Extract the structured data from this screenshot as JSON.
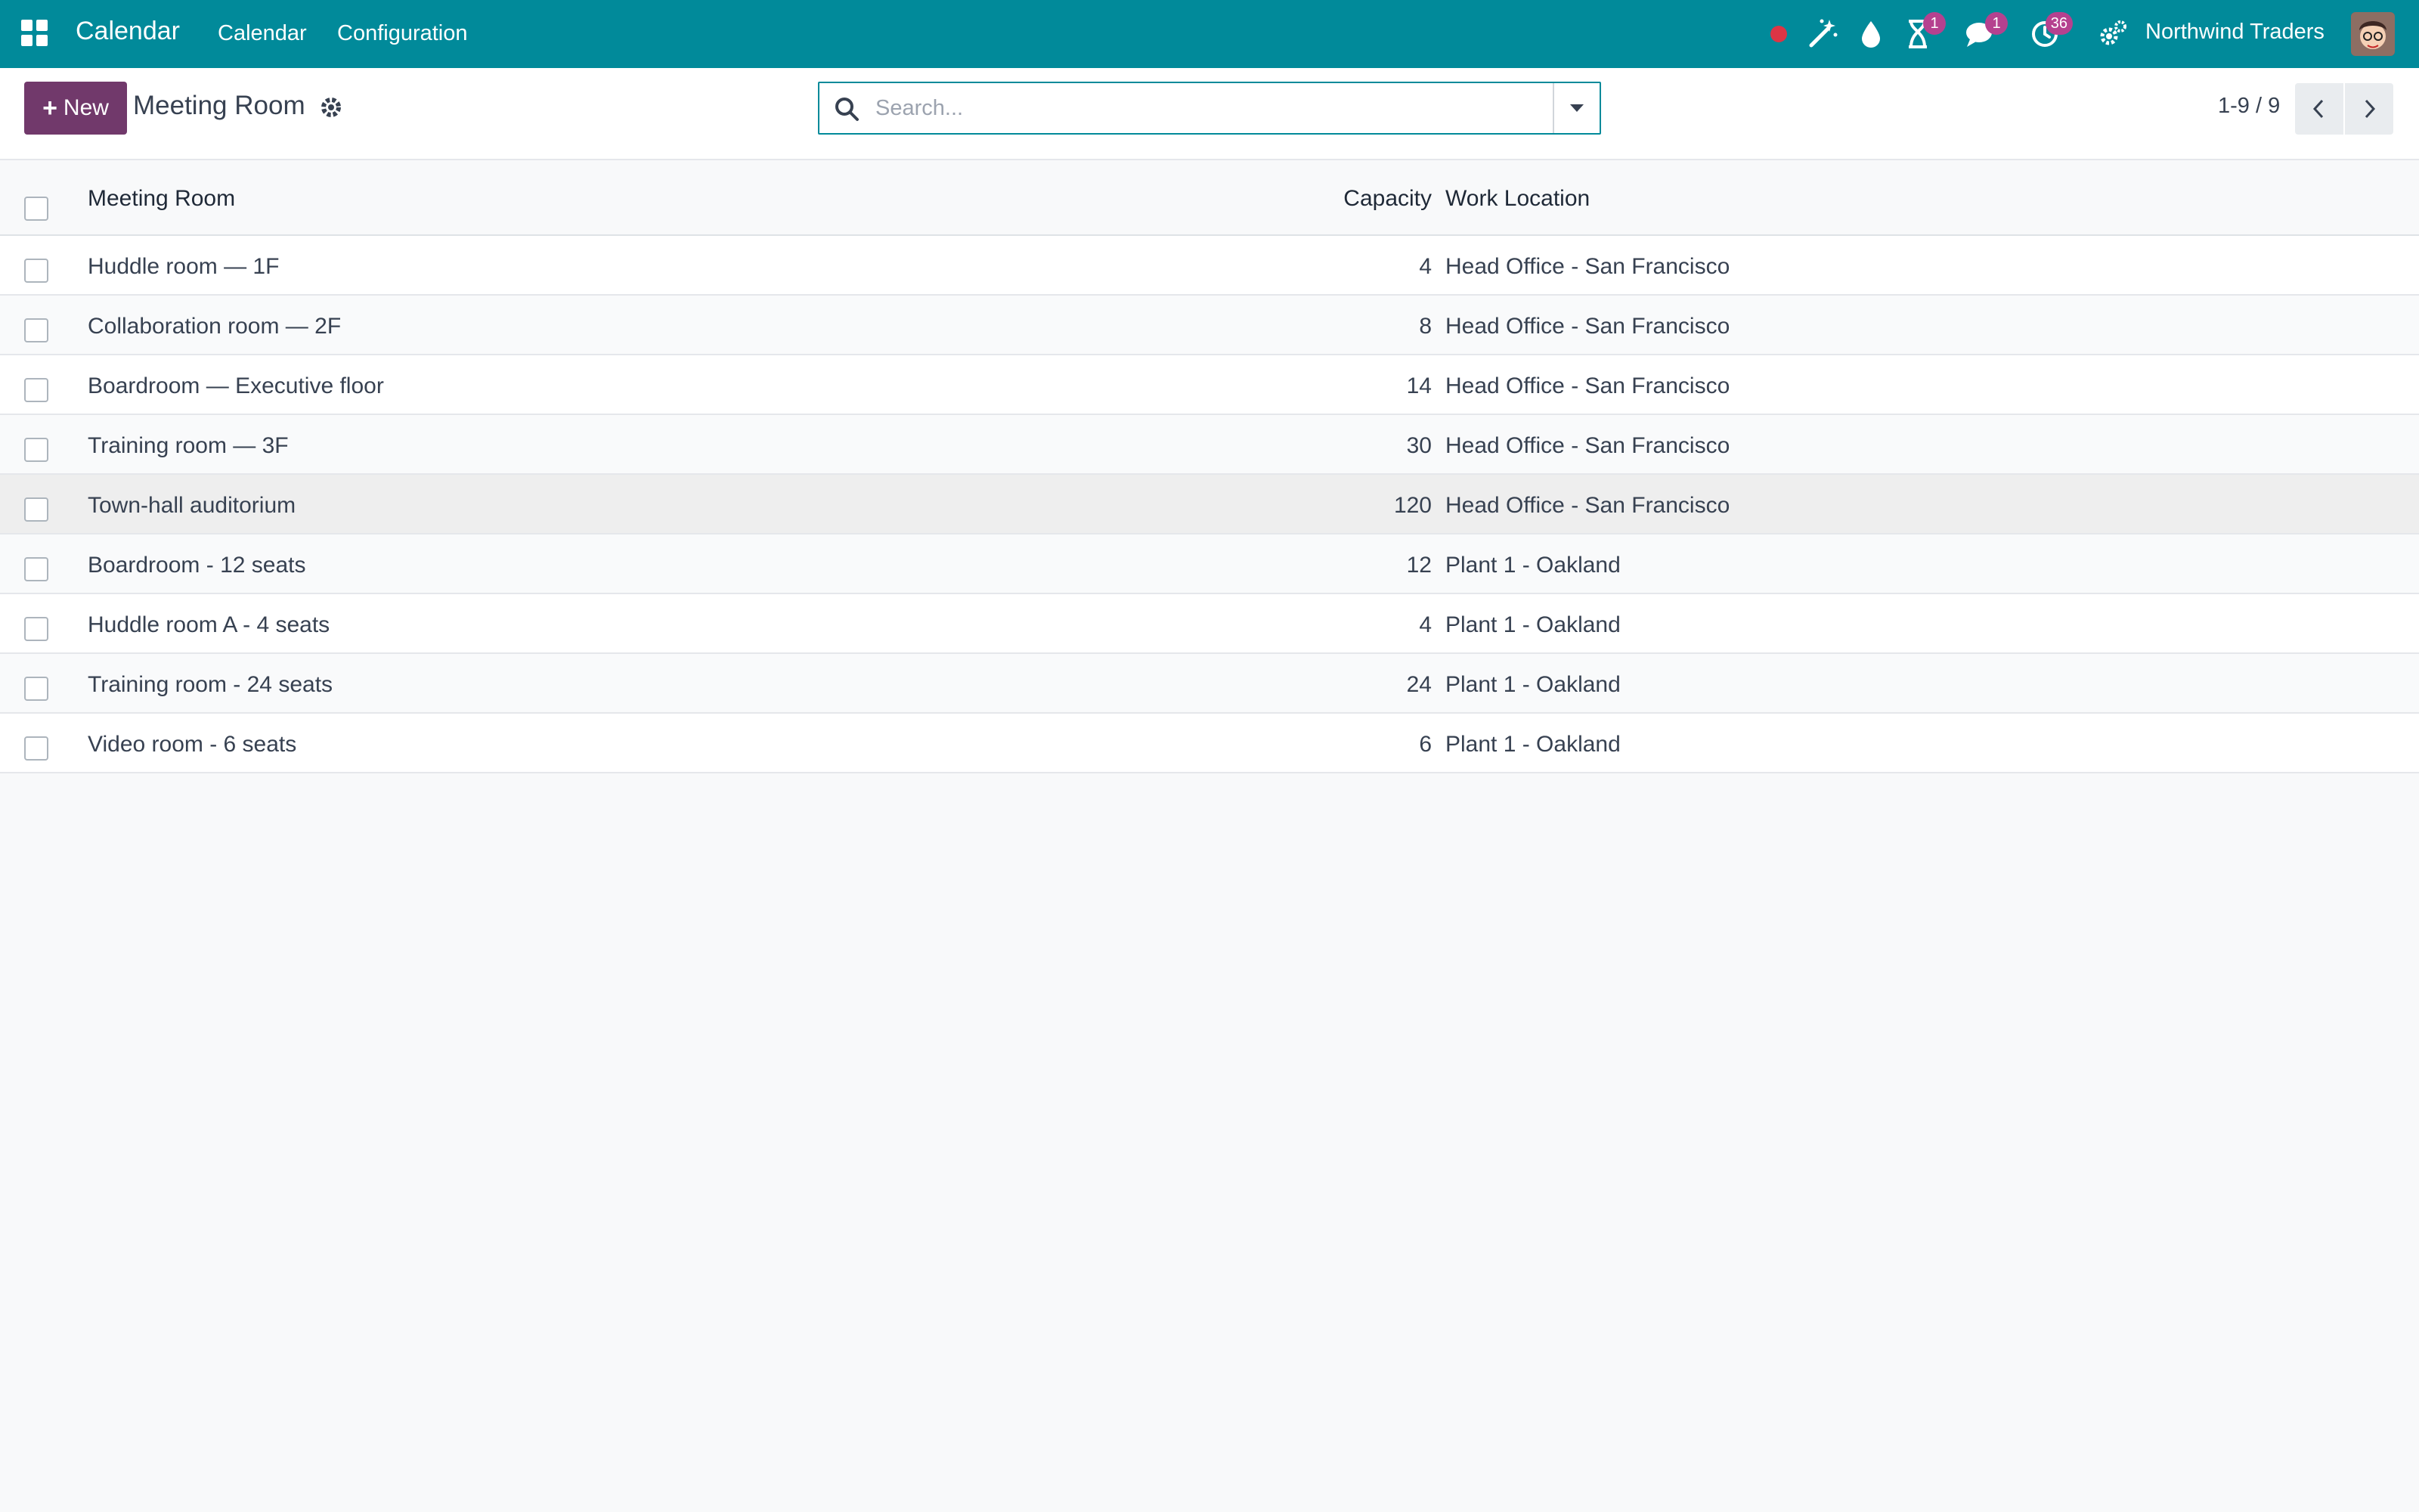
{
  "navbar": {
    "app_name": "Calendar",
    "menus": [
      "Calendar",
      "Configuration"
    ],
    "company": "Northwind Traders",
    "badges": {
      "activity": "1",
      "messages": "1",
      "timer": "36"
    },
    "icons": [
      "recording-dot-icon",
      "magic-wand-icon",
      "drop-icon",
      "hourglass-icon",
      "chat-icon",
      "clock-icon",
      "settings-icon"
    ],
    "colors": {
      "navbar": "#018a9a",
      "badge": "#b5418f",
      "record_dot": "#dc3545"
    }
  },
  "control_panel": {
    "new_label": "New",
    "title": "Meeting Room",
    "search_placeholder": "Search...",
    "pager": "1-9 / 9",
    "colors": {
      "new_button": "#71396b"
    }
  },
  "table": {
    "headers": {
      "name": "Meeting Room",
      "capacity": "Capacity",
      "location": "Work Location"
    },
    "rows": [
      {
        "name": "Huddle room — 1F",
        "capacity": "4",
        "location": "Head Office - San Francisco"
      },
      {
        "name": "Collaboration room — 2F",
        "capacity": "8",
        "location": "Head Office - San Francisco"
      },
      {
        "name": "Boardroom — Executive floor",
        "capacity": "14",
        "location": "Head Office - San Francisco"
      },
      {
        "name": "Training room — 3F",
        "capacity": "30",
        "location": "Head Office - San Francisco"
      },
      {
        "name": "Town-hall auditorium",
        "capacity": "120",
        "location": "Head Office - San Francisco"
      },
      {
        "name": "Boardroom - 12 seats",
        "capacity": "12",
        "location": "Plant 1 - Oakland"
      },
      {
        "name": "Huddle room A - 4 seats",
        "capacity": "4",
        "location": "Plant 1 - Oakland"
      },
      {
        "name": "Training room - 24 seats",
        "capacity": "24",
        "location": "Plant 1 - Oakland"
      },
      {
        "name": "Video room - 6 seats",
        "capacity": "6",
        "location": "Plant 1 - Oakland"
      }
    ]
  }
}
